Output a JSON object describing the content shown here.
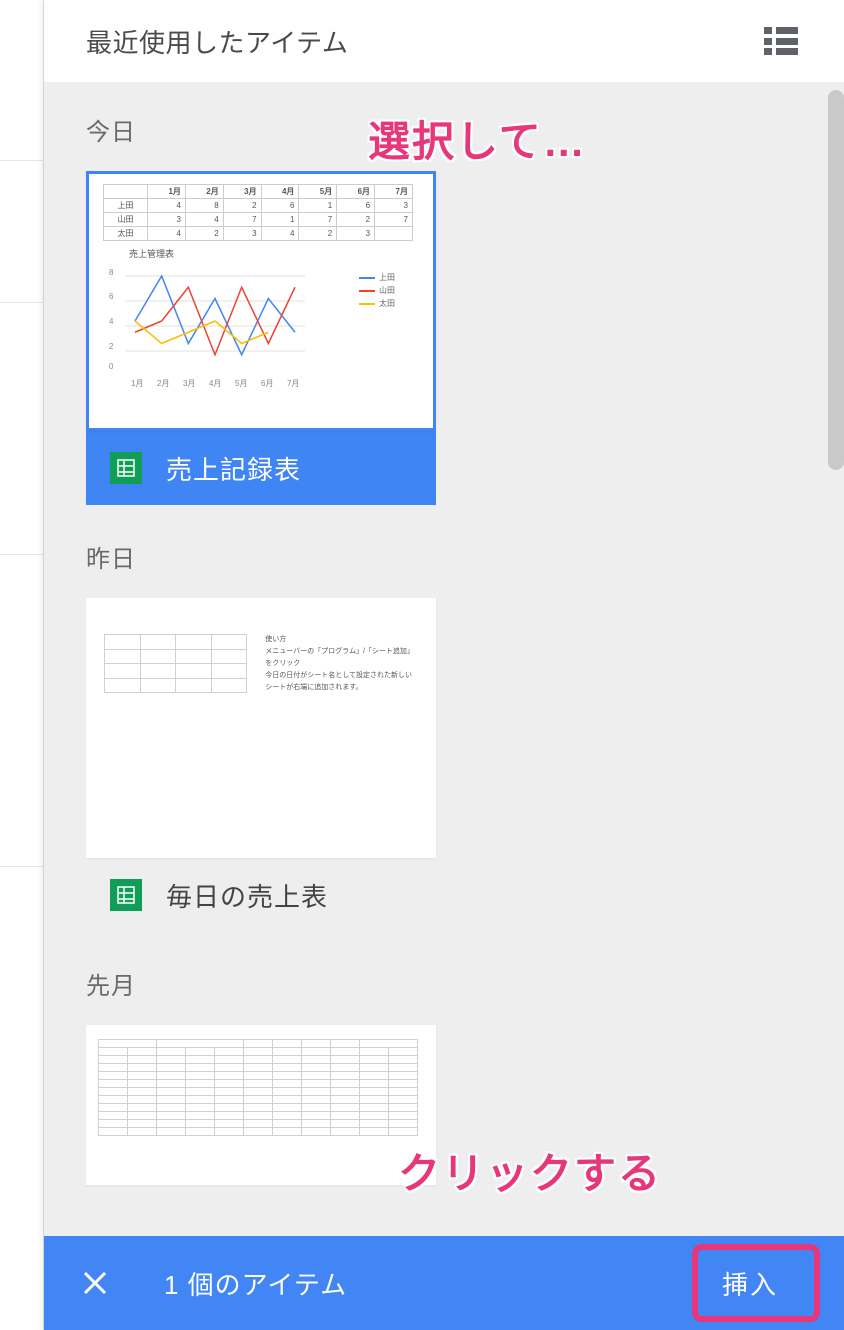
{
  "header": {
    "title": "最近使用したアイテム"
  },
  "annotations": {
    "select_hint": "選択して…",
    "click_hint": "クリックする"
  },
  "sections": {
    "today": "今日",
    "yesterday": "昨日",
    "last_month": "先月"
  },
  "items": {
    "item1_title": "売上記録表",
    "item2_title": "毎日の売上表"
  },
  "thumb1": {
    "chart_title": "売上管理表",
    "headers": [
      "",
      "1月",
      "2月",
      "3月",
      "4月",
      "5月",
      "6月",
      "7月"
    ],
    "rows": [
      [
        "上田",
        "4",
        "8",
        "2",
        "6",
        "1",
        "6",
        "3"
      ],
      [
        "山田",
        "3",
        "4",
        "7",
        "1",
        "7",
        "2",
        "7"
      ],
      [
        "太田",
        "4",
        "2",
        "3",
        "4",
        "2",
        "3",
        ""
      ]
    ],
    "legend": [
      "上田",
      "山田",
      "太田"
    ]
  },
  "footer": {
    "count_text": "1 個のアイテム",
    "insert_label": "挿入"
  },
  "chart_data": {
    "type": "line",
    "categories": [
      "1月",
      "2月",
      "3月",
      "4月",
      "5月",
      "6月",
      "7月"
    ],
    "series": [
      {
        "name": "上田",
        "values": [
          4,
          8,
          2,
          6,
          1,
          6,
          3
        ],
        "color": "#4285f4"
      },
      {
        "name": "山田",
        "values": [
          3,
          4,
          7,
          1,
          7,
          2,
          7
        ],
        "color": "#ea4335"
      },
      {
        "name": "太田",
        "values": [
          4,
          2,
          3,
          4,
          2,
          3,
          null
        ],
        "color": "#fbbc04"
      }
    ],
    "title": "売上管理表",
    "ylim": [
      0,
      8
    ]
  }
}
